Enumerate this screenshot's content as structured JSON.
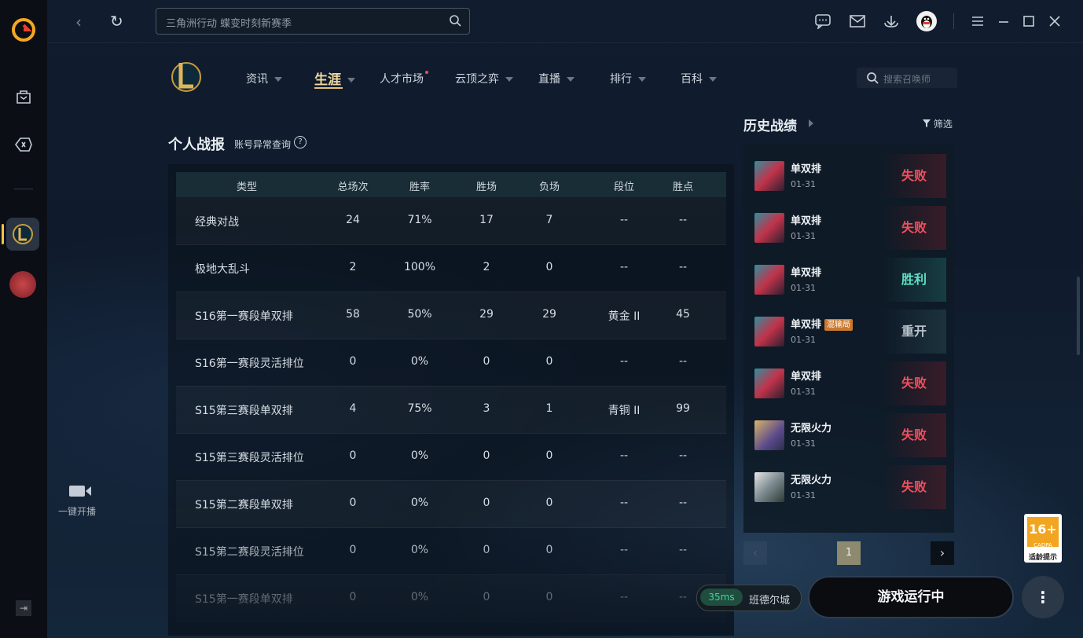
{
  "topbar": {
    "search_placeholder": "三角洲行动 蝶变时刻新赛季"
  },
  "rail": {
    "live_label": "一键开播"
  },
  "lol_nav": {
    "items": [
      {
        "label": "资讯",
        "caret": true
      },
      {
        "label": "生涯",
        "caret": true,
        "active": true
      },
      {
        "label": "人才市场",
        "caret": false,
        "dot": true
      },
      {
        "label": "云顶之弈",
        "caret": true
      },
      {
        "label": "直播",
        "caret": true
      },
      {
        "label": "排行",
        "caret": true
      },
      {
        "label": "百科",
        "caret": true
      }
    ],
    "summoner_search_placeholder": "搜索召唤师"
  },
  "report": {
    "title": "个人战报",
    "account_check": "账号异常查询",
    "help_glyph": "?",
    "columns": [
      "类型",
      "总场次",
      "胜率",
      "胜场",
      "负场",
      "段位",
      "胜点"
    ],
    "rows": [
      [
        "经典对战",
        "24",
        "71%",
        "17",
        "7",
        "--",
        "--"
      ],
      [
        "极地大乱斗",
        "2",
        "100%",
        "2",
        "0",
        "--",
        "--"
      ],
      [
        "S16第一赛段单双排",
        "58",
        "50%",
        "29",
        "29",
        "黄金 II",
        "45"
      ],
      [
        "S16第一赛段灵活排位",
        "0",
        "0%",
        "0",
        "0",
        "--",
        "--"
      ],
      [
        "S15第三赛段单双排",
        "4",
        "75%",
        "3",
        "1",
        "青铜 II",
        "99"
      ],
      [
        "S15第三赛段灵活排位",
        "0",
        "0%",
        "0",
        "0",
        "--",
        "--"
      ],
      [
        "S15第二赛段单双排",
        "0",
        "0%",
        "0",
        "0",
        "--",
        "--"
      ],
      [
        "S15第二赛段灵活排位",
        "0",
        "0%",
        "0",
        "0",
        "--",
        "--"
      ],
      [
        "S15第一赛段单双排",
        "0",
        "0%",
        "0",
        "0",
        "--",
        "--"
      ]
    ]
  },
  "history": {
    "title": "历史战绩",
    "filter_label": "筛选",
    "matches": [
      {
        "mode": "单双排",
        "date": "01-31",
        "result": "失败",
        "kind": "lose",
        "champ": "a"
      },
      {
        "mode": "单双排",
        "date": "01-31",
        "result": "失败",
        "kind": "lose",
        "champ": "a"
      },
      {
        "mode": "单双排",
        "date": "01-31",
        "result": "胜利",
        "kind": "win",
        "champ": "a"
      },
      {
        "mode": "单双排",
        "date": "01-31",
        "result": "重开",
        "kind": "remake",
        "champ": "a",
        "tag": "混输局"
      },
      {
        "mode": "单双排",
        "date": "01-31",
        "result": "失败",
        "kind": "lose",
        "champ": "a"
      },
      {
        "mode": "无限火力",
        "date": "01-31",
        "result": "失败",
        "kind": "lose",
        "champ": "b"
      },
      {
        "mode": "无限火力",
        "date": "01-31",
        "result": "失败",
        "kind": "lose",
        "champ": "c"
      }
    ],
    "page": "1"
  },
  "bottom": {
    "ping": "35ms",
    "server": "班德尔城",
    "play_label": "游戏运行中",
    "more_glyph": "⋮"
  },
  "age_rating": {
    "number": "16+",
    "org": "CADPA",
    "label": "适龄提示"
  },
  "colors": {
    "accent_gold": "#f0c34b",
    "lose": "#f0505e",
    "win": "#5ee0c6",
    "ping": "#48d29a"
  }
}
